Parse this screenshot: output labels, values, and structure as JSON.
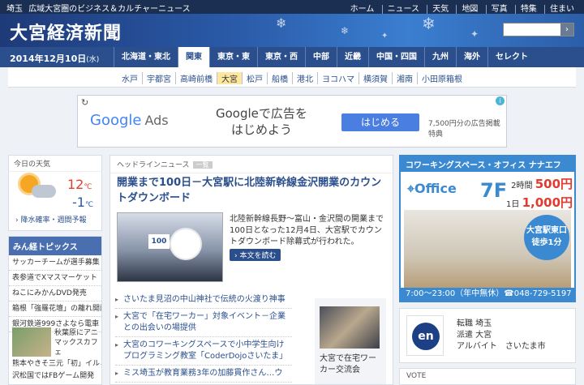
{
  "topbar": {
    "region": "埼玉",
    "tagline": "広域大宮圏のビジネス＆カルチャーニュース",
    "links": [
      "ホーム",
      "ニュース",
      "天気",
      "地図",
      "写真",
      "特集",
      "住まい"
    ]
  },
  "header": {
    "logo": "大宮経済新聞",
    "search_button": "›"
  },
  "nav": {
    "date": "2014年12月10日",
    "weekday": "(水)",
    "regions": [
      "北海道・東北",
      "関東",
      "東京・東",
      "東京・西",
      "中部",
      "近畿",
      "中国・四国",
      "九州",
      "海外",
      "セレクト"
    ],
    "active_region": "関東"
  },
  "subnav": {
    "cities": [
      "水戸",
      "宇都宮",
      "高崎前橋",
      "大宮",
      "松戸",
      "船橋",
      "港北",
      "ヨコハマ",
      "横須賀",
      "湘南",
      "小田原箱根"
    ],
    "active_city": "大宮"
  },
  "ad": {
    "google": "Google",
    "ads": "Ads",
    "line1": "Googleで広告を",
    "line2": "はじめよう",
    "button": "はじめる",
    "note": "7,500円分の広告掲載特典",
    "refresh": "↻",
    "info": "i"
  },
  "weather": {
    "title": "今日の天気",
    "high": "12",
    "low": "-1",
    "unit": "℃",
    "rain": "降水確率・週間予報"
  },
  "topics": {
    "title": "みん経トピックス",
    "items": [
      "サッカーチームが選手募集",
      "表参道でXマスマーケット",
      "ねこにみかんDVD発売",
      "箱根「強羅花壇」の離れ開講",
      "銀河鉄道999さよなら電車"
    ],
    "pic_text": "秋葉原にアニマックスカフェ",
    "bottom": [
      "熊本やきそ三元「初」イルミ",
      "沢松国ではFBゲーム開発"
    ]
  },
  "headline": {
    "label": "ヘッドラインニュース",
    "tag": "一覧",
    "title": "開業まで100日－大宮駅に北陸新幹線金沢開業のカウントダウンボード",
    "summary": "北陸新幹線長野～富山・金沢間の開業まで100日となった12月4日、大宮駅でカウントダウンボード除幕式が行われた。",
    "more": "本文を読む",
    "board": "100",
    "list": [
      "さいたま見沼の中山神社で伝統の火渡り神事",
      "大宮で「在宅ワーカー」対象イベント－企業との出会いの場提供",
      "大宮のコワーキングスペースで小中学生向けプログラミング教室「CoderDojoさいたま」",
      "ミス埼玉が教育業務3年の加藤貫作さん…ウ"
    ],
    "side_caption": "大宮で在宅ワーカー交流会"
  },
  "cowork": {
    "title": "コワーキングスペース・オフィス ナナエフ",
    "logo": "Office",
    "floor": "7F",
    "price1_label": "2時間",
    "price1": "500円",
    "price2_label": "1日",
    "price2": "1,000円",
    "circle1": "大宮駅東口",
    "circle2": "徒歩1分",
    "hours": "7:00～23:00（年中無休）☎048-729-5197"
  },
  "job": {
    "logo": "en",
    "lines": [
      "転職 埼玉",
      "派遣 大宮",
      "アルバイト　さいたま市"
    ]
  },
  "vote": {
    "title": "VOTE"
  }
}
